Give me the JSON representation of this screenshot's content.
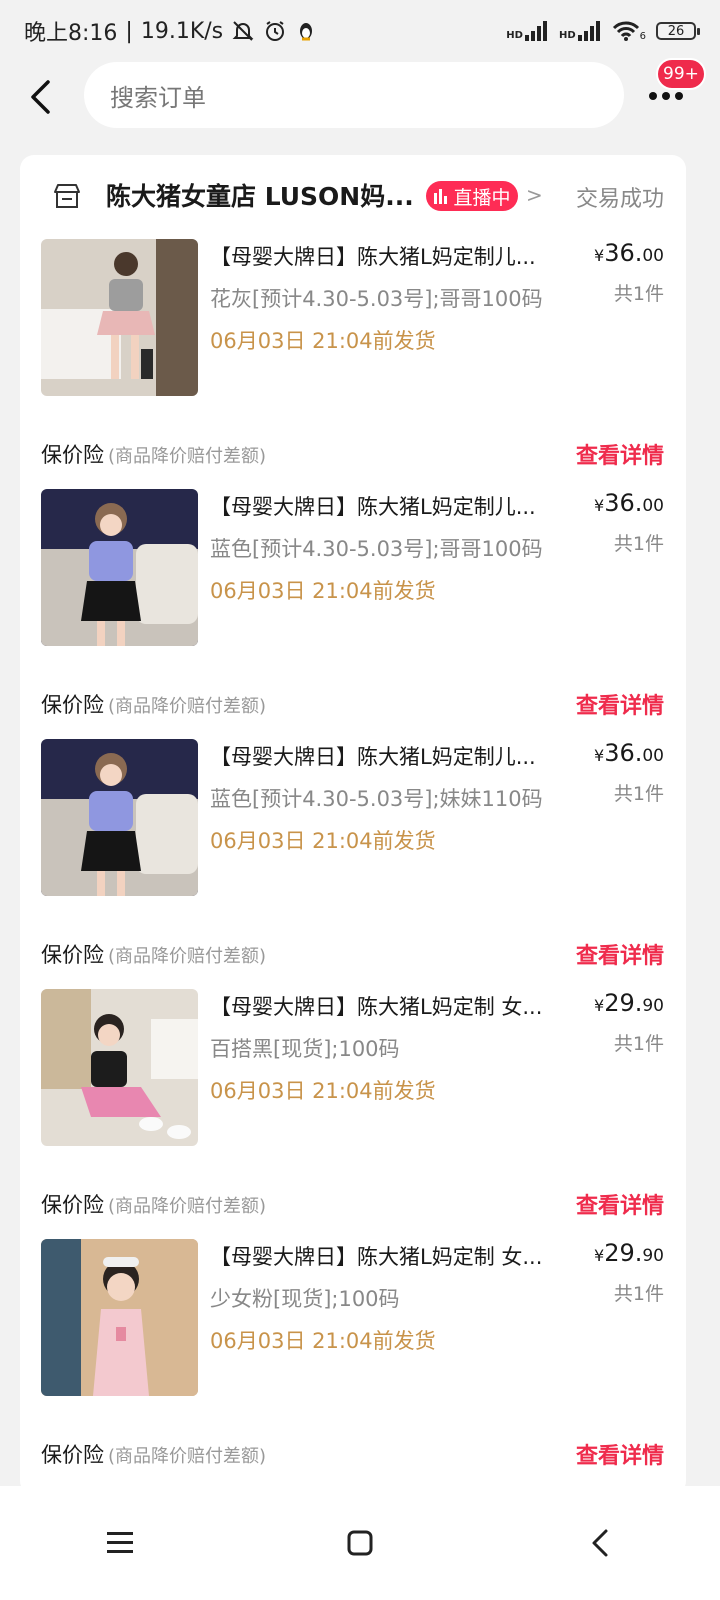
{
  "status_bar": {
    "time": "晚上8:16",
    "net_speed": "19.1K/s",
    "signal1": "HD",
    "signal2": "HD",
    "wifi_num": "6",
    "battery": "26"
  },
  "header": {
    "search_placeholder": "搜索订单",
    "badge": "99+"
  },
  "shop": {
    "name": "陈大猪女童店 LUSON妈...",
    "live_label": "直播中",
    "order_status": "交易成功"
  },
  "products": [
    {
      "title": "【母婴大牌日】陈大猪L妈定制儿...",
      "spec": "花灰[预计4.30-5.03号];哥哥100码",
      "ship": "06月03日 21:04前发货",
      "price_yen": "¥",
      "price_int": "36.",
      "price_cents": "00",
      "qty": "共1件",
      "insurance": "保价险",
      "insurance_note": "(商品降价赔付差额)",
      "detail": "查看详情",
      "thumb_colors": [
        "#cfc7bc",
        "#e8b7b6",
        "#8a7b6b"
      ]
    },
    {
      "title": "【母婴大牌日】陈大猪L妈定制儿...",
      "spec": "蓝色[预计4.30-5.03号];哥哥100码",
      "ship": "06月03日 21:04前发货",
      "price_yen": "¥",
      "price_int": "36.",
      "price_cents": "00",
      "qty": "共1件",
      "insurance": "保价险",
      "insurance_note": "(商品降价赔付差额)",
      "detail": "查看详情",
      "thumb_colors": [
        "#2b2d4e",
        "#8f97e0",
        "#151515"
      ]
    },
    {
      "title": "【母婴大牌日】陈大猪L妈定制儿...",
      "spec": "蓝色[预计4.30-5.03号];妹妹110码",
      "ship": "06月03日 21:04前发货",
      "price_yen": "¥",
      "price_int": "36.",
      "price_cents": "00",
      "qty": "共1件",
      "insurance": "保价险",
      "insurance_note": "(商品降价赔付差额)",
      "detail": "查看详情",
      "thumb_colors": [
        "#2b2d4e",
        "#8f97e0",
        "#151515"
      ]
    },
    {
      "title": "【母婴大牌日】陈大猪L妈定制 女...",
      "spec": "百搭黑[现货];100码",
      "ship": "06月03日 21:04前发货",
      "price_yen": "¥",
      "price_int": "29.",
      "price_cents": "90",
      "qty": "共1件",
      "insurance": "保价险",
      "insurance_note": "(商品降价赔付差额)",
      "detail": "查看详情",
      "thumb_colors": [
        "#d9d2c8",
        "#1c1c1c",
        "#e887b0"
      ]
    },
    {
      "title": "【母婴大牌日】陈大猪L妈定制 女...",
      "spec": "少女粉[现货];100码",
      "ship": "06月03日 21:04前发货",
      "price_yen": "¥",
      "price_int": "29.",
      "price_cents": "90",
      "qty": "共1件",
      "insurance": "保价险",
      "insurance_note": "(商品降价赔付差额)",
      "detail": "查看详情",
      "thumb_colors": [
        "#c9a680",
        "#f3c9cf",
        "#f1e7dd"
      ]
    }
  ],
  "icons": {
    "back": "back-arrow-icon",
    "more": "more-dots-icon",
    "shop": "shop-icon",
    "live": "live-bars-icon",
    "nav_menu": "menu-icon",
    "nav_home": "home-icon",
    "nav_back": "back-icon"
  }
}
